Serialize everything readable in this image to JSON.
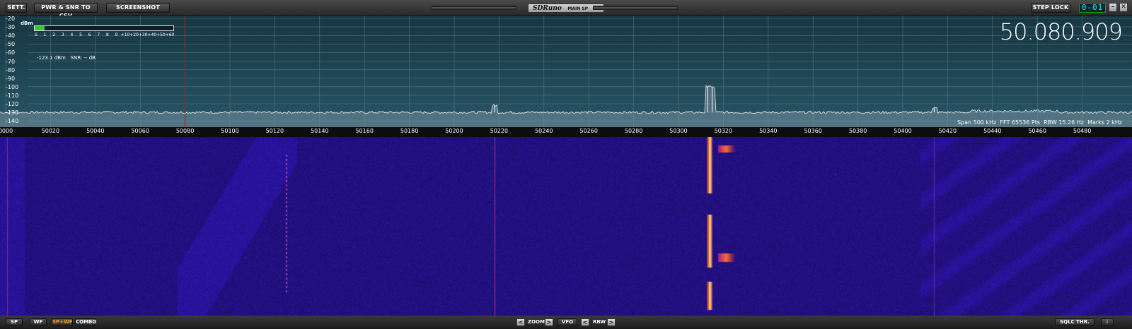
{
  "toolbar": {
    "settings_label": "SETT.",
    "export_label": "PWR & SNR TO CSV",
    "screenshot_label": "SCREENSHOT",
    "app_brand": "SDRuno",
    "panel_name": "MAIN SP",
    "step_lock_label": "STEP LOCK",
    "lcd_value": "0-01",
    "minimize_glyph": "–",
    "close_glyph": "✕"
  },
  "spectrum": {
    "db_unit": "dBm",
    "y_ticks": [
      "-20",
      "-30",
      "-40",
      "-50",
      "-60",
      "-70",
      "-80",
      "-90",
      "-100",
      "-110",
      "-120",
      "-130",
      "-140"
    ],
    "smeter_scale": [
      "S",
      "1",
      "2",
      "3",
      "4",
      "5",
      "6",
      "7",
      "8",
      "9",
      "+10",
      "+20",
      "+30",
      "+40",
      "+50",
      "+60"
    ],
    "smeter_level_fraction": 0.07,
    "power_readout": "-123.1 dBm",
    "snr_readout": "SNR: -- dB",
    "frequency_display": "50.080.909",
    "info_span": "Span 500 kHz",
    "info_fft": "FFT 65536 Pts",
    "info_rbw": "RBW 15.26 Hz",
    "info_marks": "Marks 2 kHz",
    "noise_floor_dbm": -130,
    "tuned_marker_khz": 50080,
    "peaks": [
      {
        "freq_khz": 50218,
        "level_dbm": -122
      },
      {
        "freq_khz": 50313,
        "level_dbm": -100
      },
      {
        "freq_khz": 50315,
        "level_dbm": -101
      },
      {
        "freq_khz": 50414,
        "level_dbm": -125
      }
    ]
  },
  "freq_axis": {
    "labels": [
      "0000",
      "50020",
      "50040",
      "50060",
      "50080",
      "50100",
      "50120",
      "50140",
      "50160",
      "50180",
      "50200",
      "50220",
      "50240",
      "50260",
      "50280",
      "50300",
      "50320",
      "50340",
      "50360",
      "50380",
      "50400",
      "50420",
      "50440",
      "50460",
      "50480"
    ]
  },
  "bottom": {
    "sp_label": "SP",
    "wf_label": "WF",
    "spwf_label": "SP+WF",
    "combo_label": "COMBO",
    "zoom_label": "ZOOM",
    "vfo_label": "VFO",
    "rbw_label": "RBW",
    "left_arrow": "<",
    "right_arrow": ">",
    "sqlc_label": "SQLC THR.",
    "info_label": "i"
  },
  "colors": {
    "spectrum_top": "#173642",
    "spectrum_bottom": "#285565",
    "waterfall_bg": "#0b0838",
    "marker_red": "#d01010",
    "smeter_green": "#33cc33",
    "active_button": "#f39a2c"
  }
}
